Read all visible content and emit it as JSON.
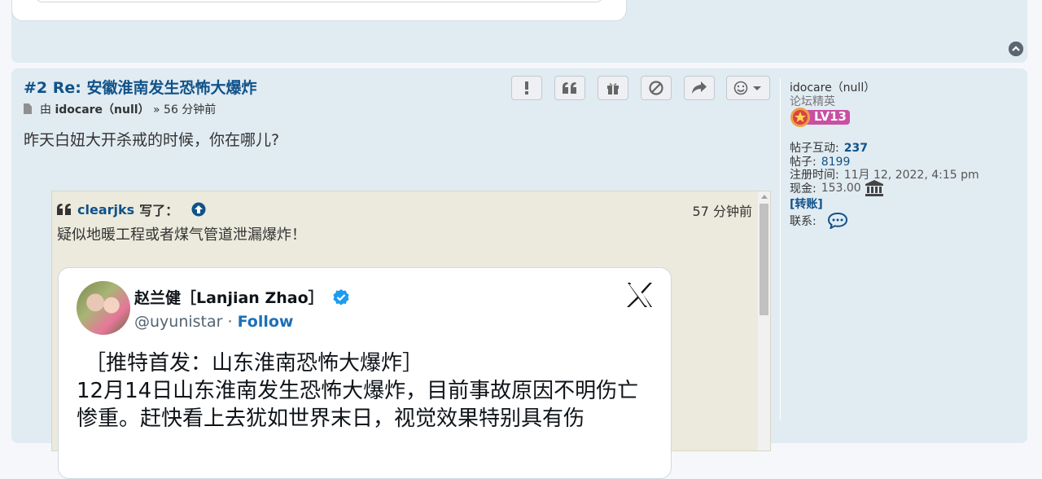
{
  "post": {
    "title": "#2 Re: 安徽淮南发生恐怖大爆炸",
    "meta_by": "由",
    "author": "idocare（null）",
    "meta_time": "» 56 分钟前",
    "content": "昨天白妞大开杀戒的时候，你在哪儿?"
  },
  "actions": [
    "report-icon",
    "quote-icon",
    "gift-icon",
    "block-icon",
    "share-icon",
    "emoji-icon"
  ],
  "quote": {
    "user": "clearjks",
    "wrote": "写了：",
    "time": "57 分钟前",
    "text": "疑似地暖工程或者煤气管道泄漏爆炸！"
  },
  "tweet": {
    "name": "赵兰健［Lanjian Zhao］",
    "handle": "@uyunistar",
    "separator": " · ",
    "follow": "Follow",
    "body_line1": "［推特首发：山东淮南恐怖大爆炸］",
    "body_line2": "12月14日山东淮南发生恐怖大爆炸，目前事故原因不明伤亡惨重。赶快看上去犹如世界末日，视觉效果特别具有伤"
  },
  "sidebar": {
    "username": "idocare（null）",
    "rank": "论坛精英",
    "level": "LV13",
    "interactions_label": "帖子互动:",
    "interactions_value": "237",
    "posts_label": "帖子:",
    "posts_value": "8199",
    "joined_label": "注册时间:",
    "joined_value": "11月 12, 2022, 4:15 pm",
    "cash_label": "现金:",
    "cash_value": "153.00",
    "transfer": "[转账]",
    "contact_label": "联系:"
  },
  "colors": {
    "link": "#105289",
    "post_bg": "#e1ebf2",
    "quote_bg": "#ebeadd",
    "follow": "#1d70b8"
  }
}
